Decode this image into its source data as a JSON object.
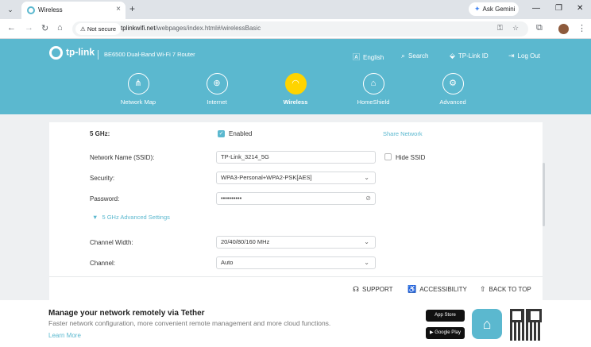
{
  "browser": {
    "tab_title": "Wireless",
    "new_tab": "+",
    "gemini": "Ask Gemini",
    "security_chip": "Not secure",
    "url_host": "tplinkwifi.net",
    "url_path": "/webpages/index.html#/wirelessBasic"
  },
  "header": {
    "brand": "tp-link",
    "model": "BE6500 Dual-Band Wi-Fi 7 Router",
    "links": {
      "language": "English",
      "search": "Search",
      "tplink_id": "TP-Link ID",
      "logout": "Log Out"
    },
    "nav": [
      {
        "label": "Network Map",
        "icon": "network-map-icon"
      },
      {
        "label": "Internet",
        "icon": "globe-icon"
      },
      {
        "label": "Wireless",
        "icon": "wifi-icon",
        "active": true
      },
      {
        "label": "HomeShield",
        "icon": "home-shield-icon"
      },
      {
        "label": "Advanced",
        "icon": "gear-icon"
      }
    ]
  },
  "wireless": {
    "band_label": "5 GHz:",
    "enabled_label": "Enabled",
    "share_network": "Share Network",
    "ssid_label": "Network Name (SSID):",
    "ssid_value": "TP-Link_3214_5G",
    "hide_ssid_label": "Hide SSID",
    "security_label": "Security:",
    "security_value": "WPA3-Personal+WPA2-PSK[AES]",
    "password_label": "Password:",
    "password_value": "••••••••••",
    "advanced_toggle": "5 GHz Advanced Settings",
    "channel_width_label": "Channel Width:",
    "channel_width_value": "20/40/80/160 MHz",
    "channel_label": "Channel:",
    "channel_value": "Auto"
  },
  "footer": {
    "support": "SUPPORT",
    "accessibility": "ACCESSIBILITY",
    "back_to_top": "BACK TO TOP"
  },
  "banner": {
    "title": "Manage your network remotely via Tether",
    "description": "Faster network configuration, more convenient remote management and more cloud functions.",
    "learn_more": "Learn More",
    "app_store": "App Store",
    "google_play": "Google Play"
  },
  "colors": {
    "accent": "#5bb8cf",
    "active_nav": "#ffd400"
  }
}
